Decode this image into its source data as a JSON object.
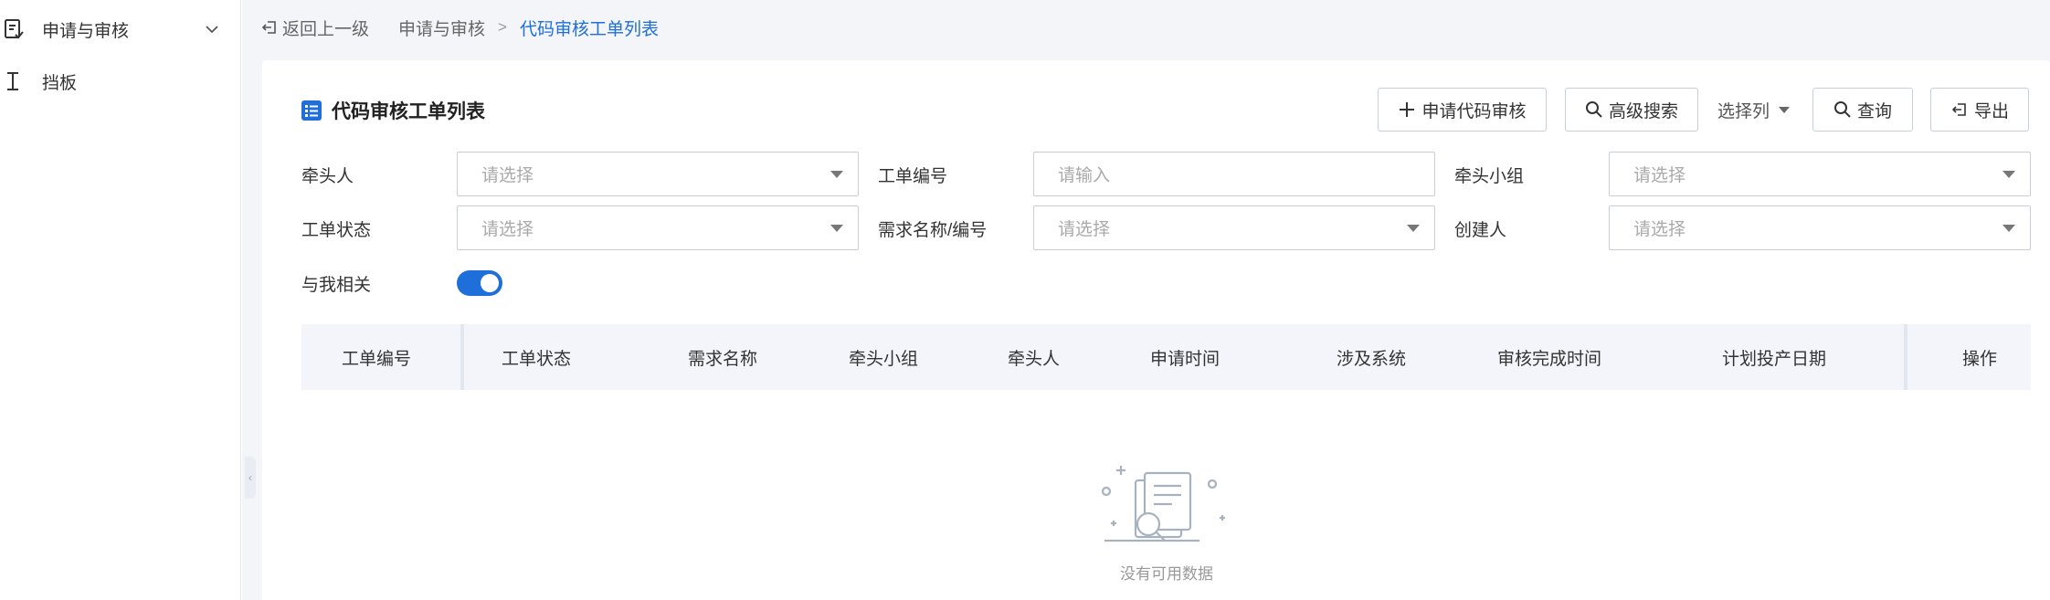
{
  "sidebar": {
    "items": [
      {
        "label": "申请与审核",
        "icon": "document-list-icon"
      },
      {
        "label": "挡板",
        "icon": "text-cursor-icon"
      }
    ]
  },
  "breadcrumb": {
    "back_label": "返回上一级",
    "parent": "申请与审核",
    "current": "代码审核工单列表"
  },
  "page": {
    "title": "代码审核工单列表"
  },
  "toolbar": {
    "apply_label": "申请代码审核",
    "advanced_search_label": "高级搜索",
    "select_columns_label": "选择列",
    "query_label": "查询",
    "export_label": "导出"
  },
  "filters": {
    "lead_person": {
      "label": "牵头人",
      "placeholder": "请选择"
    },
    "ticket_no": {
      "label": "工单编号",
      "placeholder": "请输入"
    },
    "lead_group": {
      "label": "牵头小组",
      "placeholder": "请选择"
    },
    "ticket_status": {
      "label": "工单状态",
      "placeholder": "请选择"
    },
    "requirement": {
      "label": "需求名称/编号",
      "placeholder": "请选择"
    },
    "creator": {
      "label": "创建人",
      "placeholder": "请选择"
    },
    "related_to_me": {
      "label": "与我相关",
      "enabled": true
    }
  },
  "table": {
    "columns": [
      "工单编号",
      "工单状态",
      "需求名称",
      "牵头小组",
      "牵头人",
      "申请时间",
      "涉及系统",
      "审核完成时间",
      "计划投产日期",
      "操作"
    ],
    "rows": [],
    "empty_text": "没有可用数据"
  },
  "colors": {
    "accent": "#1e6fd9",
    "header_bg": "#f3f5fa",
    "page_bg": "#f3f5f9"
  }
}
